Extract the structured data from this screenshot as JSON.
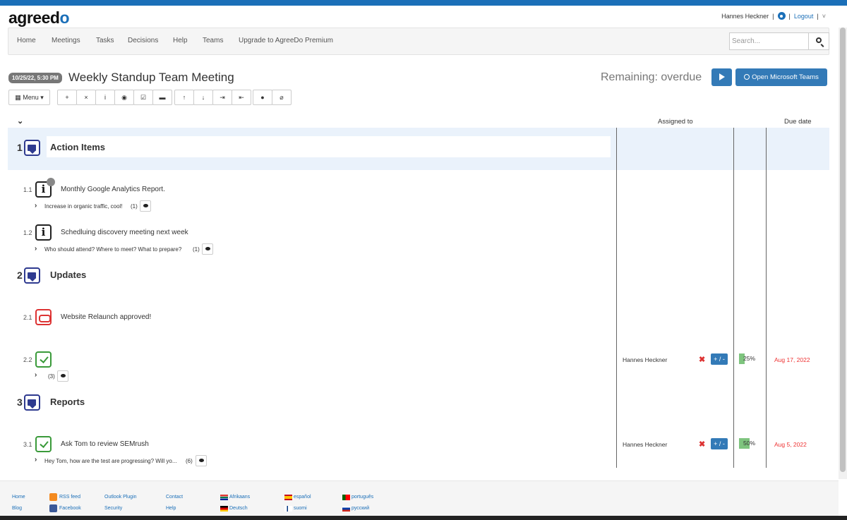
{
  "header": {
    "logo_prefix": "agreed",
    "logo_suffix": "o",
    "user_name": "Hannes Heckner",
    "separator": "|",
    "logout": "Logout",
    "menu_chevron": "˅"
  },
  "nav": {
    "items": [
      "Home",
      "Meetings",
      "Tasks",
      "Decisions",
      "Help",
      "Teams",
      "Upgrade to AgreeDo Premium"
    ],
    "search_placeholder": "Search..."
  },
  "meeting": {
    "date_badge": "10/25/22, 5:30 PM",
    "title": "Weekly Standup Team Meeting",
    "remaining": "Remaining: overdue",
    "teams_button": "Open Microsoft Teams"
  },
  "toolbar": {
    "menu_label": "Menu",
    "buttons": [
      "add-icon",
      "delete-icon",
      "info-icon",
      "eye-icon",
      "task-icon",
      "folder-icon",
      "arrow-up-icon",
      "arrow-down-icon",
      "indent-icon",
      "outdent-icon",
      "comment-icon",
      "attachment-icon"
    ],
    "glyphs": [
      "+",
      "×",
      "i",
      "◉",
      "☑",
      "▬",
      "↑",
      "↓",
      "⇥",
      "⇤",
      "●",
      "⌀"
    ]
  },
  "columns": {
    "assigned_to": "Assigned to",
    "due_date": "Due date"
  },
  "agenda": {
    "sections": [
      {
        "num": "1",
        "title": "Action Items"
      },
      {
        "num": "2",
        "title": "Updates"
      },
      {
        "num": "3",
        "title": "Reports"
      }
    ],
    "items": [
      {
        "num": "1.1",
        "type": "info",
        "text": "Monthly Google Analytics Report.",
        "sub": "Increase in organic traffic, cool!",
        "count": "(1)"
      },
      {
        "num": "1.2",
        "type": "info",
        "text": "Schedluing discovery meeting next week",
        "sub": "Who should attend? Where to meet? What to prepare?",
        "count": "(1)"
      },
      {
        "num": "2.1",
        "type": "decision",
        "text": "Website Relaunch approved!"
      },
      {
        "num": "2.2",
        "type": "task",
        "text": "",
        "sub": "",
        "count": "(3)",
        "assignee": "Hannes Heckner",
        "progress": 25,
        "progress_label": "25%",
        "due": "Aug 17, 2022"
      },
      {
        "num": "3.1",
        "type": "task",
        "text": "Ask Tom to review SEMrush",
        "sub": "Hey Tom, how are the test are progressing? Will yo...",
        "count": "(6)",
        "assignee": "Hannes Heckner",
        "progress": 50,
        "progress_label": "50%",
        "due": "Aug 5, 2022"
      }
    ],
    "plusminus": "+ / -",
    "remove_mark": "✖"
  },
  "footer": {
    "links": [
      "Home",
      "Blog",
      "RSS feed",
      "Facebook",
      "Outlook Plugin",
      "Security",
      "Contact",
      "Help"
    ],
    "languages": [
      "Afrikaans",
      "Deutsch",
      "español",
      "suomi",
      "português",
      "русский"
    ]
  },
  "colors": {
    "brand_blue": "#1b6fb8",
    "button_blue": "#337ab7",
    "section_bg": "#eaf2fb",
    "due_red": "#e33",
    "progress_green": "#7ec47e"
  }
}
